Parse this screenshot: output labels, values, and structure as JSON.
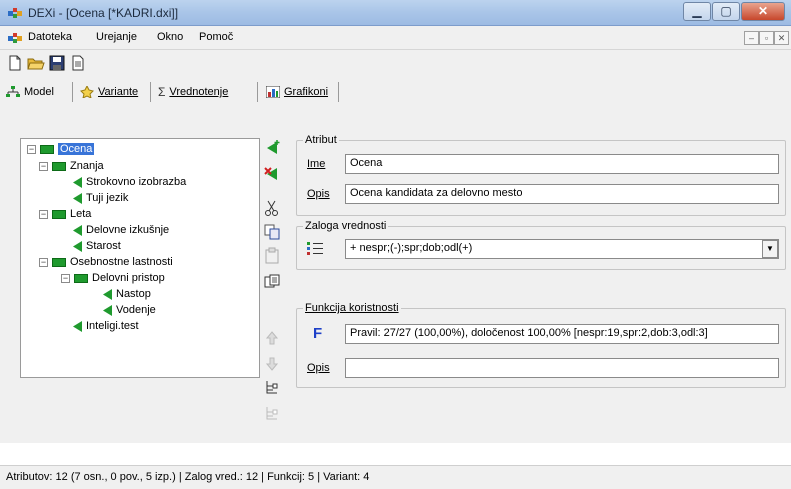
{
  "window": {
    "title": "DEXi - [Ocena [*KADRI.dxi]]"
  },
  "menubar": {
    "items": [
      "Datoteka",
      "Urejanje",
      "Okno",
      "Pomoč"
    ]
  },
  "toolbar": {
    "icons": [
      "new-file-icon",
      "open-folder-icon",
      "save-icon",
      "report-icon"
    ]
  },
  "tabs": [
    {
      "label": "Model",
      "active": true
    },
    {
      "label": "Variante",
      "active": false
    },
    {
      "label": "Vrednotenje",
      "active": false
    },
    {
      "label": "Grafikoni",
      "active": false
    }
  ],
  "tree": {
    "nodes": [
      {
        "label": "Ocena",
        "type": "aggregate",
        "expander": "−",
        "selected": true
      },
      {
        "label": "Znanja",
        "type": "aggregate",
        "expander": "−"
      },
      {
        "label": "Strokovno izobrazba",
        "type": "basic"
      },
      {
        "label": "Tuji jezik",
        "type": "basic"
      },
      {
        "label": "Leta",
        "type": "aggregate",
        "expander": "−"
      },
      {
        "label": "Delovne izkušnje",
        "type": "basic"
      },
      {
        "label": "Starost",
        "type": "basic"
      },
      {
        "label": "Osebnostne lastnosti",
        "type": "aggregate",
        "expander": "−"
      },
      {
        "label": "Delovni pristop",
        "type": "aggregate",
        "expander": "−"
      },
      {
        "label": "Nastop",
        "type": "basic"
      },
      {
        "label": "Vodenje",
        "type": "basic"
      },
      {
        "label": "Inteligi.test",
        "type": "basic"
      }
    ]
  },
  "attribute": {
    "group_label": "Atribut",
    "name_label": "Ime",
    "name_value": "Ocena",
    "desc_label": "Opis",
    "desc_value": "Ocena kandidata za delovno mesto"
  },
  "scale": {
    "group_label": "Zaloga vrednosti",
    "value": "+ nespr;(-);spr;dob;odl(+)"
  },
  "function": {
    "group_label": "Funkcija koristnosti",
    "f_glyph": "F",
    "value": "Pravil: 27/27 (100,00%), določenost 100,00% [nespr:19,spr:2,dob:3,odl:3]",
    "desc_label": "Opis",
    "desc_value": ""
  },
  "status": {
    "text": "Atributov: 12 (7 osn., 0 pov., 5 izp.)  |  Zalog vred.: 12  |  Funkcij: 5  |  Variant: 4"
  },
  "colors": {
    "selection": "#3874d8",
    "aggregate_node": "#1f9a2e",
    "function_glyph": "#1e40c8"
  }
}
